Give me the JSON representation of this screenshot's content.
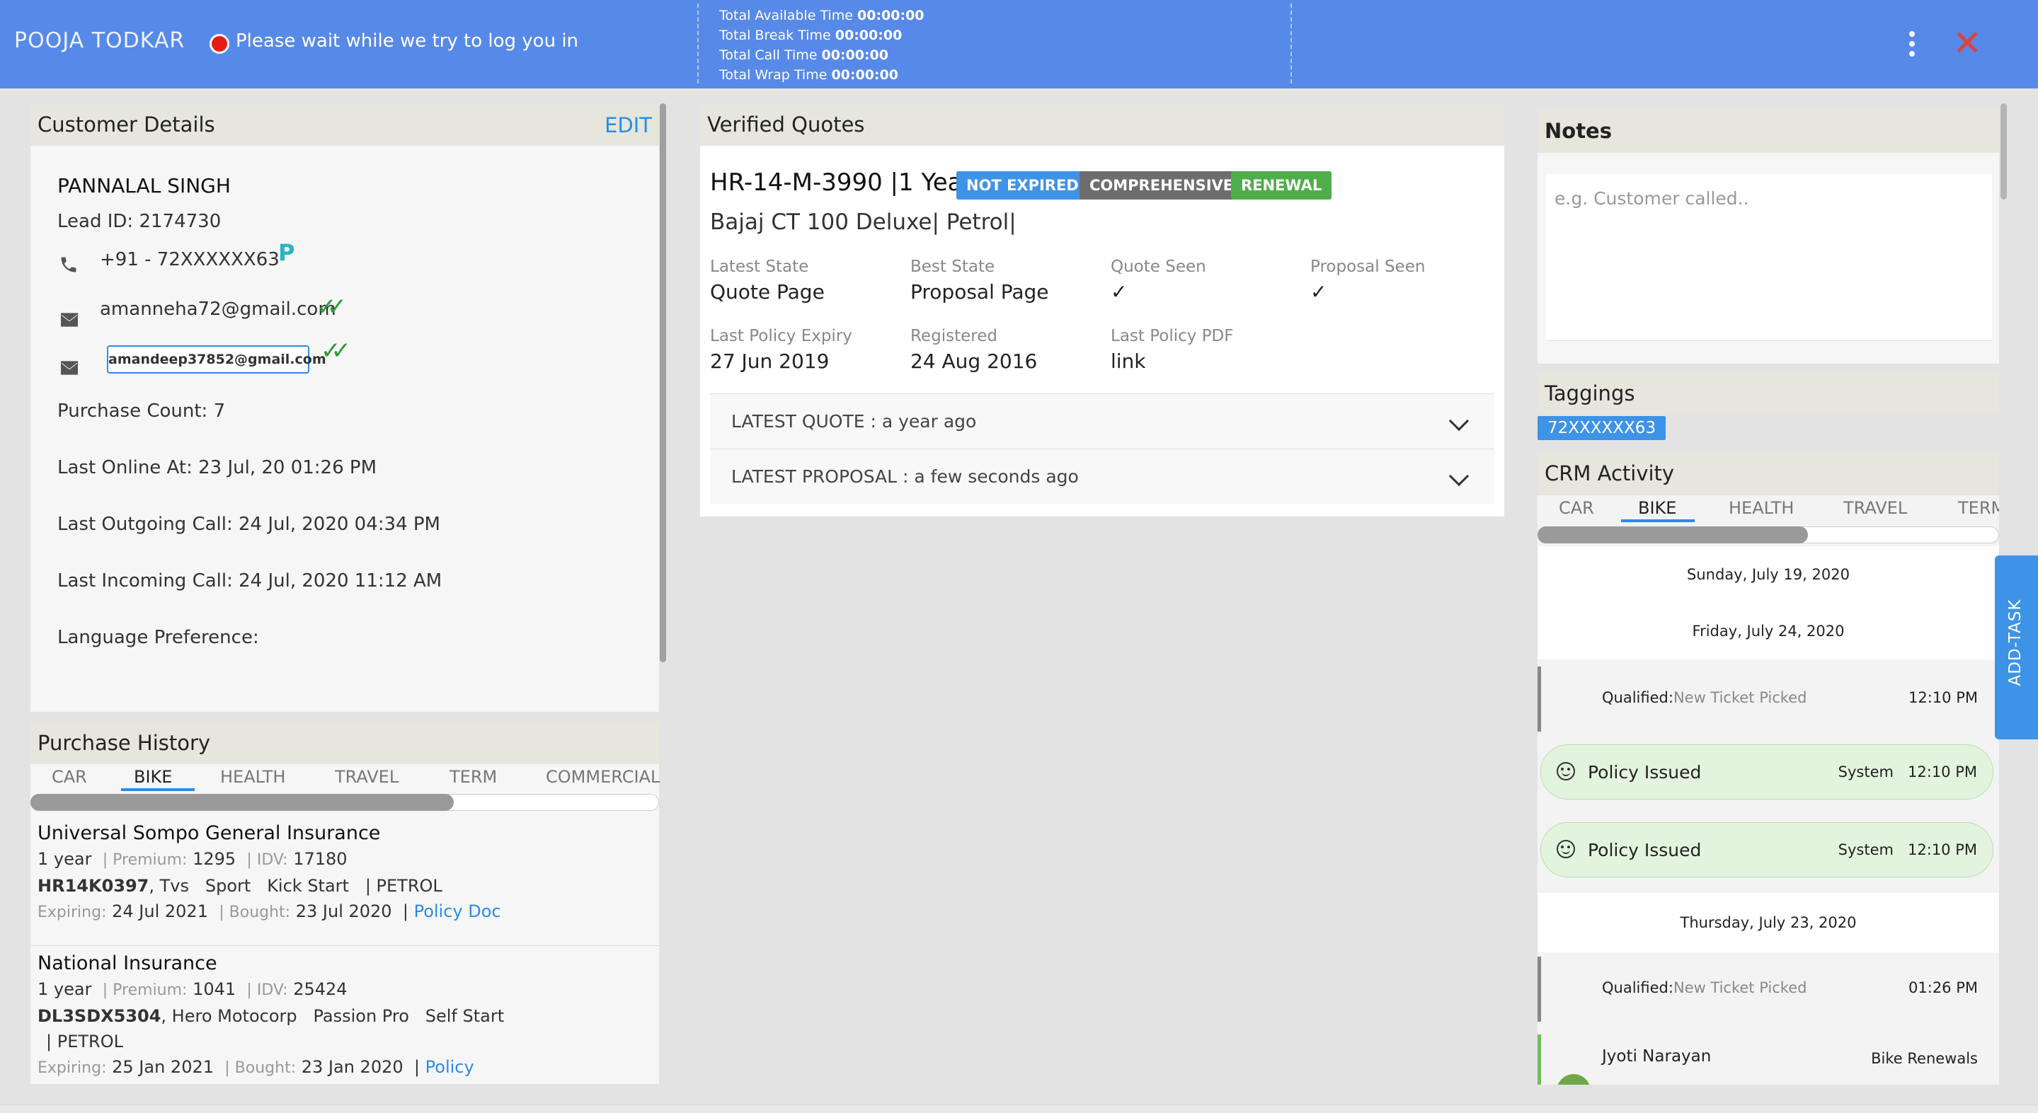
{
  "header": {
    "agent_name": "POOJA TODKAR",
    "status_text": "Please wait while we try to log you in",
    "timers": [
      {
        "label": "Total Available Time",
        "value": "00:00:00"
      },
      {
        "label": "Total Break Time",
        "value": "00:00:00"
      },
      {
        "label": "Total Call Time",
        "value": "00:00:00"
      },
      {
        "label": "Total Wrap Time",
        "value": "00:00:00"
      }
    ],
    "close_glyph": "✕"
  },
  "customer": {
    "title": "Customer Details",
    "edit_label": "EDIT",
    "name": "PANNALAL SINGH",
    "lead_id": "Lead ID: 2174730",
    "phone": "+91 - 72XXXXXX63",
    "phone_badge": "P",
    "email1": "amanneha72@gmail.com",
    "email2": "amandeep37852@gmail.com",
    "purchase_count": "Purchase Count: 7",
    "last_online": "Last Online At: 23 Jul, 20 01:26 PM",
    "last_outgoing": "Last Outgoing Call: 24 Jul, 2020 04:34 PM",
    "last_incoming": "Last Incoming Call: 24 Jul, 2020 11:12 AM",
    "language": "Language Preference:"
  },
  "purchase_history": {
    "title": "Purchase History",
    "tabs": [
      "CAR",
      "BIKE",
      "HEALTH",
      "TRAVEL",
      "TERM",
      "COMMERCIAL"
    ],
    "active_tab": "BIKE",
    "items": [
      {
        "insurer": "Universal Sompo General Insurance",
        "term": "1 year",
        "premium_label": "| Premium:",
        "premium": "1295",
        "idv_label": "| IDV:",
        "idv": "17180",
        "reg": "HR14K0397",
        "vehicle": ", Tvs   Sport   Kick Start   | PETROL",
        "expiring_label": "Expiring:",
        "expiring": "24 Jul 2021",
        "bought_label": "| Bought:",
        "bought": "23 Jul 2020",
        "doc_sep": "|",
        "doc_link": "Policy Doc"
      },
      {
        "insurer": "National Insurance",
        "term": "1 year",
        "premium_label": "| Premium:",
        "premium": "1041",
        "idv_label": "| IDV:",
        "idv": "25424",
        "reg": "DL3SDX5304",
        "vehicle": ", Hero Motocorp   Passion Pro   Self Start",
        "fuel": "| PETROL",
        "expiring_label": "Expiring:",
        "expiring": "25 Jan 2021",
        "bought_label": "| Bought:",
        "bought": "23 Jan 2020",
        "doc_sep": "|",
        "doc_link": "Policy"
      }
    ]
  },
  "quotes": {
    "title": "Verified Quotes",
    "reg_term": "HR-14-M-3990 |1 Year",
    "badges": [
      {
        "label": "NOT EXPIRED",
        "color": "#3d93e8"
      },
      {
        "label": "COMPREHENSIVE",
        "color": "#6d6d6d"
      },
      {
        "label": "RENEWAL",
        "color": "#4fae4a"
      }
    ],
    "vehicle": "Bajaj CT 100 Deluxe| Petrol|",
    "fields": [
      {
        "key": "Latest State",
        "value": "Quote Page"
      },
      {
        "key": "Best State",
        "value": "Proposal Page"
      },
      {
        "key": "Quote Seen",
        "value": "✓"
      },
      {
        "key": "Proposal Seen",
        "value": "✓"
      },
      {
        "key": "Last Policy Expiry",
        "value": "27 Jun 2019"
      },
      {
        "key": "Registered",
        "value": "24 Aug 2016"
      },
      {
        "key": "Last Policy PDF",
        "value": "link"
      }
    ],
    "latest_quote": "LATEST QUOTE : a year ago",
    "latest_proposal": "LATEST PROPOSAL : a few seconds ago"
  },
  "notes": {
    "title": "Notes",
    "placeholder": "e.g. Customer called.."
  },
  "taggings": {
    "title": "Taggings",
    "tag": "72XXXXXX63"
  },
  "crm": {
    "title": "CRM Activity",
    "tabs": [
      "CAR",
      "BIKE",
      "HEALTH",
      "TRAVEL",
      "TERM"
    ],
    "active_tab": "BIKE",
    "date1": "Sunday, July 19, 2020",
    "date2": "Friday, July 24, 2020",
    "item1": {
      "status": "Qualified",
      "detail": "New Ticket Picked",
      "time": "12:10 PM"
    },
    "pill1": {
      "label": "Policy Issued",
      "by": "System",
      "time": "12:10 PM"
    },
    "pill2": {
      "label": "Policy Issued",
      "by": "System",
      "time": "12:10 PM"
    },
    "date3": "Thursday, July 23, 2020",
    "item2": {
      "status": "Qualified",
      "detail": "New Ticket Picked",
      "time": "01:26 PM"
    },
    "item3": {
      "name": "Jyoti Narayan",
      "team": "Bike Renewals"
    }
  },
  "add_task_label": "ADD-TASK"
}
